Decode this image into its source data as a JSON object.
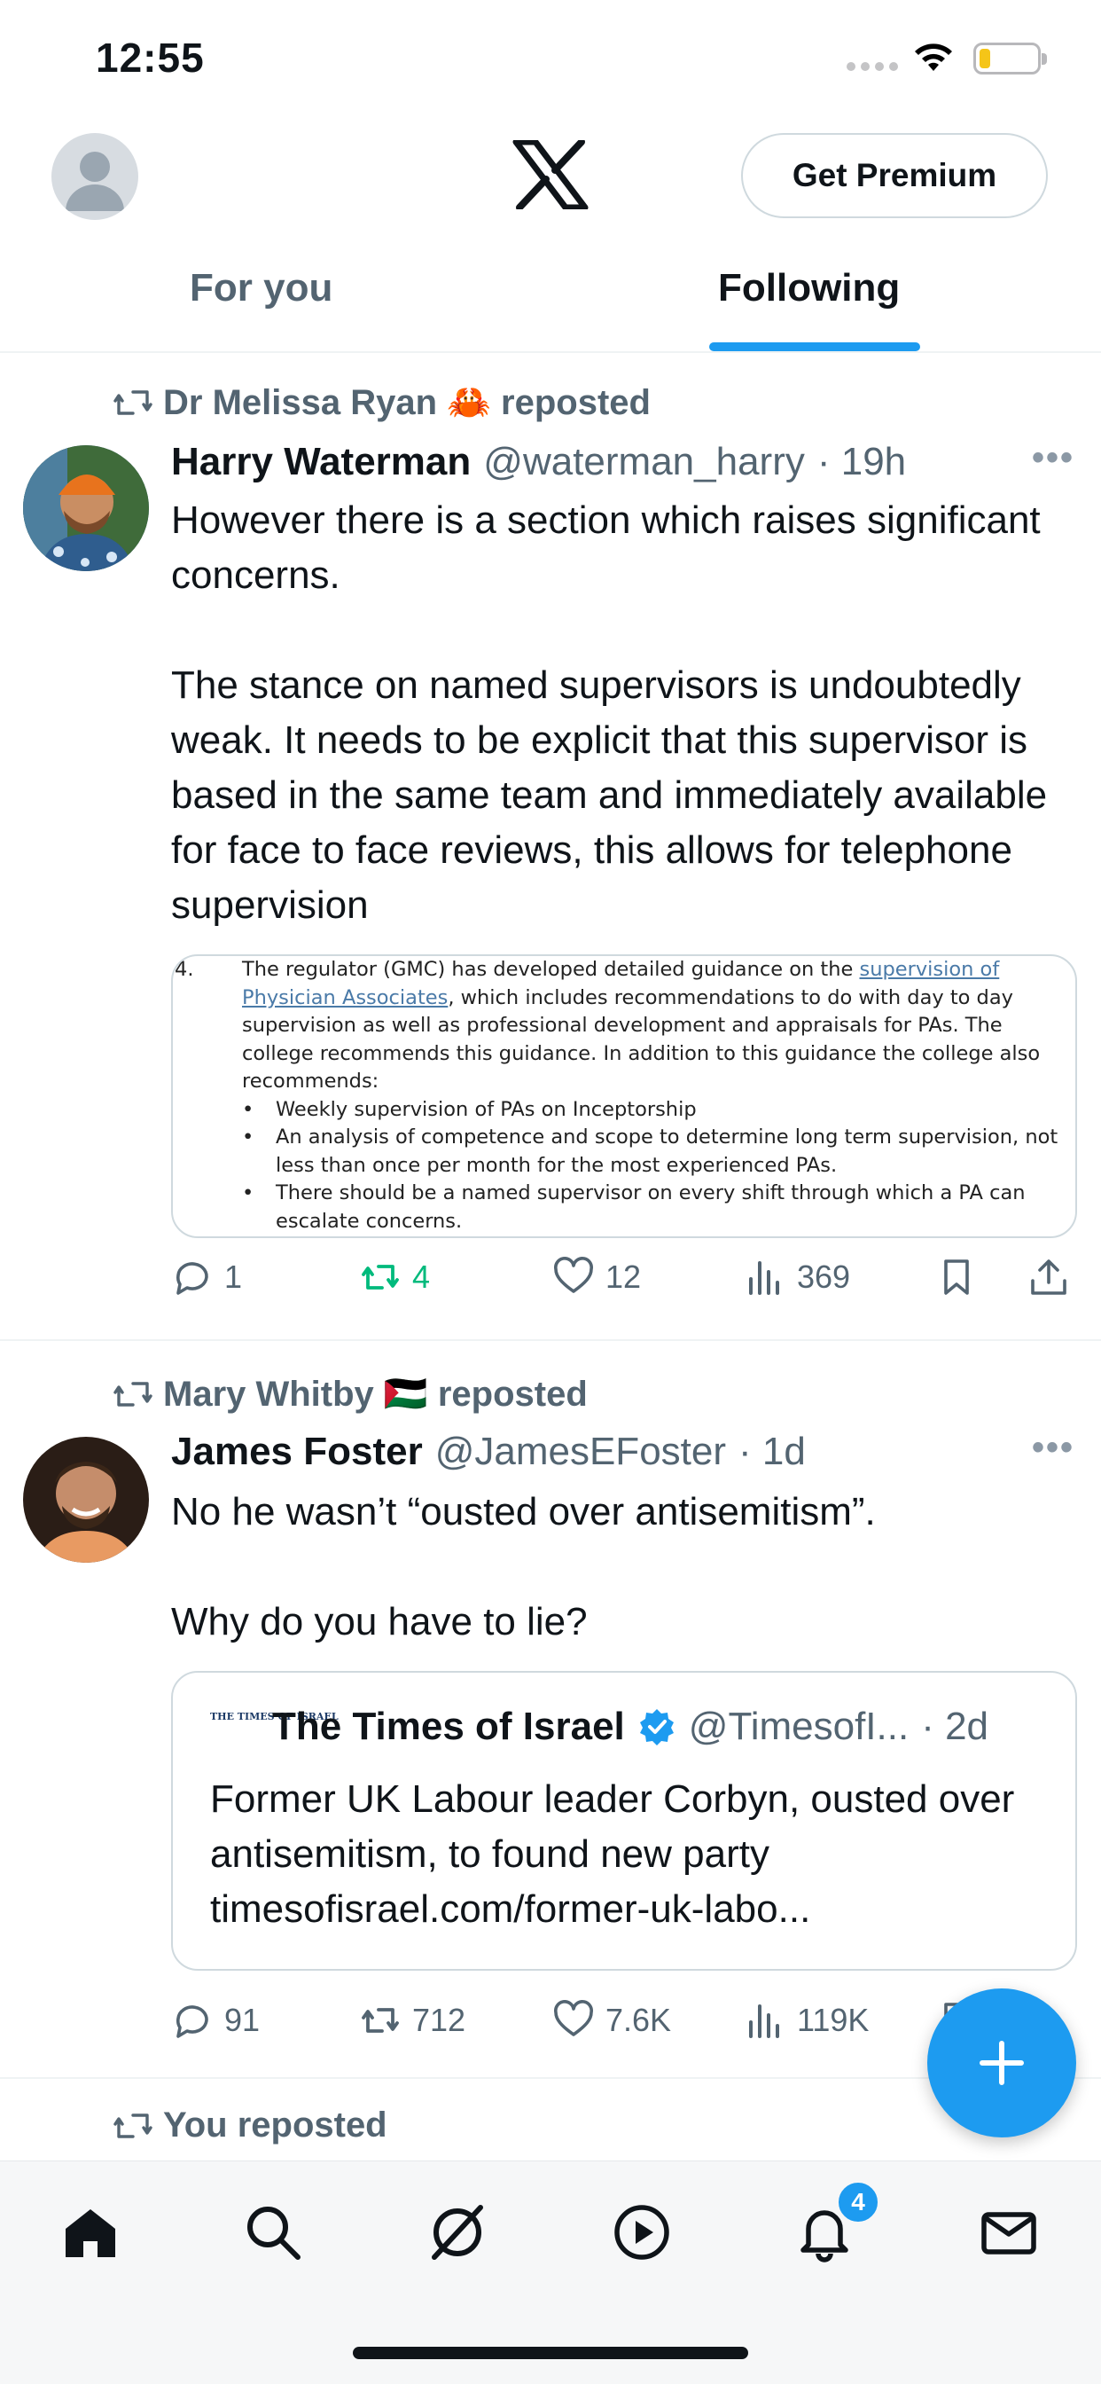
{
  "status_bar": {
    "time": "12:55",
    "signal_icon": "signal-dots-icon",
    "wifi_icon": "wifi-icon",
    "battery_icon": "battery-low-icon",
    "battery_color": "#f5c518"
  },
  "header": {
    "avatar_icon": "default-avatar-icon",
    "logo_icon": "x-logo-icon",
    "premium_label": "Get Premium"
  },
  "tabs": [
    {
      "label": "For you",
      "active": false
    },
    {
      "label": "Following",
      "active": true
    }
  ],
  "accent_color": "#1d9bf0",
  "tweets": [
    {
      "repost_by": "Dr Melissa Ryan 🦀 reposted",
      "name": "Harry Waterman",
      "handle": "@waterman_harry",
      "time": "· 19h",
      "text": "However there is a section which raises significant concerns.\n\nThe stance on named supervisors is undoubtedly weak. It needs to be explicit that this supervisor is based in the same team and immediately available for face to face reviews, this allows for telephone supervision",
      "doc": {
        "number": "4.",
        "pre_link": "The regulator (GMC) has developed detailed guidance on the ",
        "link": "supervision of Physician Associates",
        "post_link": ", which includes recommendations to do with day to day supervision as well as professional development and appraisals for PAs.  The college recommends this guidance. In addition to this guidance the college also recommends:",
        "bullets": [
          "Weekly supervision of PAs on Inceptorship",
          "An analysis of competence and scope to determine long term supervision, not less than once per month for the most experienced PAs.",
          "There should be a named supervisor on every shift through which a PA can escalate concerns."
        ]
      },
      "actions": {
        "replies": "1",
        "reposts": "4",
        "likes": "12",
        "views": "369"
      }
    },
    {
      "repost_by": "Mary Whitby 🇵🇸 reposted",
      "name": "James Foster",
      "handle": "@JamesEFoster",
      "time": "· 1d",
      "text": "No he wasn’t “ousted over antisemitism”.\n\nWhy do you have to lie?",
      "quote": {
        "logo_text": "THE TIMES OF ISRAEL",
        "name": "The Times of Israel",
        "handle": "@TimesofI...",
        "time": "· 2d",
        "text": "Former UK Labour leader Corbyn, ousted over antisemitism, to found new party\ntimesofisrael.com/former-uk-labo..."
      },
      "actions": {
        "replies": "91",
        "reposts": "712",
        "likes": "7.6K",
        "views": "119K"
      }
    }
  ],
  "third_repost": "You reposted",
  "fab_icon": "plus-icon",
  "bottom_nav": {
    "items": [
      "home-icon",
      "search-icon",
      "grok-icon",
      "video-play-icon",
      "notifications-bell-icon",
      "messages-icon"
    ],
    "notification_count": "4"
  }
}
